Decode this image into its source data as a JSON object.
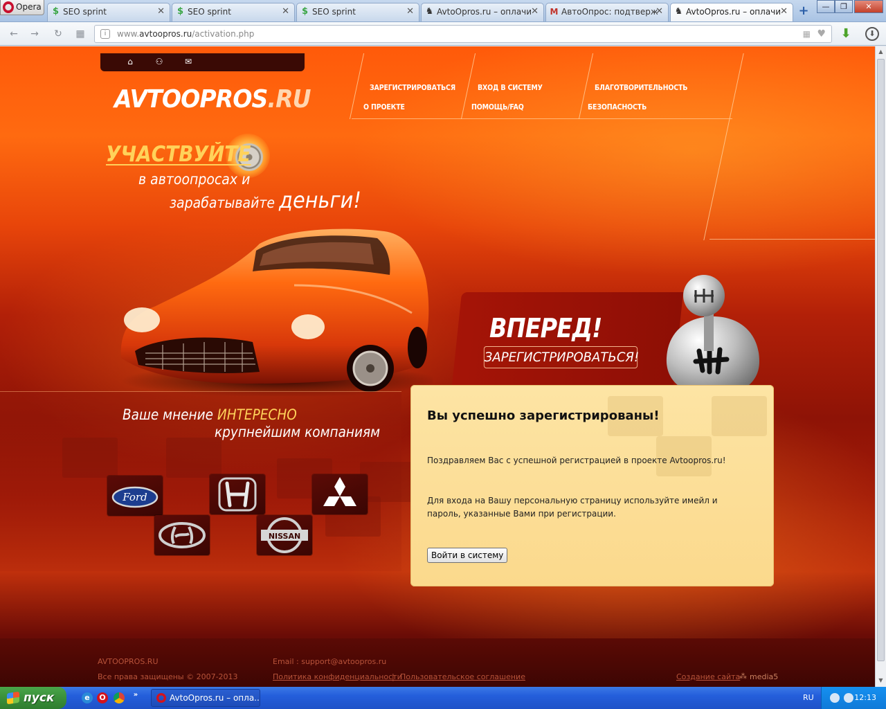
{
  "browser": {
    "menu_label": "Opera",
    "tabs": [
      {
        "title": "SEO sprint",
        "icon": "dollar-icon"
      },
      {
        "title": "SEO sprint",
        "icon": "dollar-icon"
      },
      {
        "title": "SEO sprint",
        "icon": "dollar-icon"
      },
      {
        "title": "AvtoOpros.ru – оплачи",
        "icon": "site-icon"
      },
      {
        "title": "АвтоОпрос: подтверж",
        "icon": "gmail-icon"
      },
      {
        "title": "AvtoOpros.ru – оплачи",
        "icon": "site-icon"
      }
    ],
    "active_tab": 5,
    "url_prefix": "www.",
    "url_domain": "avtoopros.ru",
    "url_path": "/activation.php"
  },
  "site": {
    "logo_main": "AVTOOPROS",
    "logo_ru": ".RU",
    "nav": {
      "register": "ЗАРЕГИСТРИРОВАТЬСЯ",
      "login": "ВХОД В СИСТЕМУ",
      "charity": "БЛАГОТВОРИТЕЛЬНОСТЬ",
      "about": "О ПРОЕКТЕ",
      "help": "ПОМОЩЬ/FAQ",
      "security": "БЕЗОПАСНОСТЬ"
    },
    "slogan": {
      "line1": "УЧАСТВУЙТЕ",
      "line2": "в автоопросах и",
      "line3": "зарабатывайте",
      "line3_big": "деньги!"
    },
    "forward": {
      "title": "ВПЕРЕД!",
      "button": "ЗАРЕГИСТРИРОВАТЬСЯ!"
    },
    "opinion": {
      "line1_a": "Ваше мнение",
      "line1_b": "ИНТЕРЕСНО",
      "line2": "крупнейшим компаниям"
    },
    "brands": {
      "ford": "Ford",
      "nissan": "NISSAN"
    },
    "success": {
      "title": "Вы успешно зарегистрированы!",
      "p1": "Поздравляем Вас с успешной регистрацией в проекте Avtoopros.ru!",
      "p2": "Для входа на Вашу персональную страницу используйте имейл и пароль, указанные Вами при регистрации.",
      "button": "Войти в систему"
    },
    "footer": {
      "brand": "AVTOOPROS.RU",
      "copyright": "Все права защищены © 2007-2013",
      "email": "Email : support@avtoopros.ru",
      "privacy": "Политика конфиденциальности",
      "separator": "|",
      "agreement": "Пользовательское соглашение",
      "dev": "Создание сайта",
      "dev_brand": "media5"
    }
  },
  "taskbar": {
    "start": "пуск",
    "task": "AvtoOpros.ru – опла...",
    "lang": "RU",
    "time": "12:13"
  }
}
